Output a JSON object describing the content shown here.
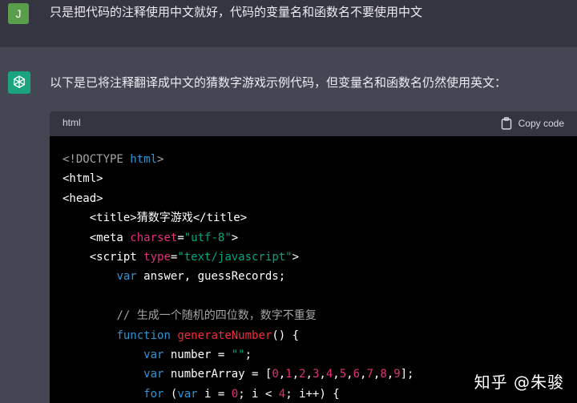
{
  "user_message": {
    "avatar_letter": "J",
    "text": "只是把代码的注释使用中文就好，代码的变量名和函数名不要使用中文"
  },
  "assistant_message": {
    "intro": "以下是已将注释翻译成中文的猜数字游戏示例代码，但变量名和函数名仍然使用英文："
  },
  "code_block": {
    "language": "html",
    "copy_label": "Copy code",
    "lines": [
      [
        [
          "doctype",
          "<!DOCTYPE "
        ],
        [
          "kw",
          "html"
        ],
        [
          "doctype",
          ">"
        ]
      ],
      [
        [
          "tag",
          "<html>"
        ]
      ],
      [
        [
          "tag",
          "<head>"
        ]
      ],
      [
        [
          "tag",
          "    <title>猜数字游戏</title>"
        ]
      ],
      [
        [
          "tag",
          "    <meta "
        ],
        [
          "attr",
          "charset"
        ],
        [
          "tag",
          "="
        ],
        [
          "str",
          "\"utf-8\""
        ],
        [
          "tag",
          ">"
        ]
      ],
      [
        [
          "tag",
          "    <script "
        ],
        [
          "attr",
          "type"
        ],
        [
          "tag",
          "="
        ],
        [
          "str",
          "\"text/javascript\""
        ],
        [
          "tag",
          ">"
        ]
      ],
      [
        [
          "tag",
          "        "
        ],
        [
          "kw",
          "var"
        ],
        [
          "tag",
          " answer, guessRecords;"
        ]
      ],
      [
        [
          "tag",
          ""
        ]
      ],
      [
        [
          "tag",
          "        "
        ],
        [
          "cm",
          "// 生成一个随机的四位数，数字不重复"
        ]
      ],
      [
        [
          "tag",
          "        "
        ],
        [
          "kw",
          "function"
        ],
        [
          "tag",
          " "
        ],
        [
          "fn",
          "generateNumber"
        ],
        [
          "tag",
          "() {"
        ]
      ],
      [
        [
          "tag",
          "            "
        ],
        [
          "kw",
          "var"
        ],
        [
          "tag",
          " number = "
        ],
        [
          "str",
          "\"\""
        ],
        [
          "tag",
          ";"
        ]
      ],
      [
        [
          "tag",
          "            "
        ],
        [
          "kw",
          "var"
        ],
        [
          "tag",
          " numberArray = ["
        ],
        [
          "num",
          "0"
        ],
        [
          "tag",
          ","
        ],
        [
          "num",
          "1"
        ],
        [
          "tag",
          ","
        ],
        [
          "num",
          "2"
        ],
        [
          "tag",
          ","
        ],
        [
          "num",
          "3"
        ],
        [
          "tag",
          ","
        ],
        [
          "num",
          "4"
        ],
        [
          "tag",
          ","
        ],
        [
          "num",
          "5"
        ],
        [
          "tag",
          ","
        ],
        [
          "num",
          "6"
        ],
        [
          "tag",
          ","
        ],
        [
          "num",
          "7"
        ],
        [
          "tag",
          ","
        ],
        [
          "num",
          "8"
        ],
        [
          "tag",
          ","
        ],
        [
          "num",
          "9"
        ],
        [
          "tag",
          "];"
        ]
      ],
      [
        [
          "tag",
          "            "
        ],
        [
          "kw",
          "for"
        ],
        [
          "tag",
          " ("
        ],
        [
          "kw",
          "var"
        ],
        [
          "tag",
          " i = "
        ],
        [
          "num",
          "0"
        ],
        [
          "tag",
          "; i < "
        ],
        [
          "num",
          "4"
        ],
        [
          "tag",
          "; i++) {"
        ]
      ]
    ]
  },
  "watermark": "知乎 @朱骏",
  "colors": {
    "background_user": "#343541",
    "background_assistant": "#444654",
    "user_avatar": "#5a9e4b",
    "gpt_avatar": "#19a37f",
    "code_background": "#000000",
    "keyword": "#2e95d3",
    "attribute": "#df3079",
    "string": "#00a67d",
    "function_name": "#f22c3d",
    "comment": "#a5a5a5"
  },
  "icons": {
    "gpt_avatar": "openai-logo-icon",
    "copy": "clipboard-icon"
  }
}
